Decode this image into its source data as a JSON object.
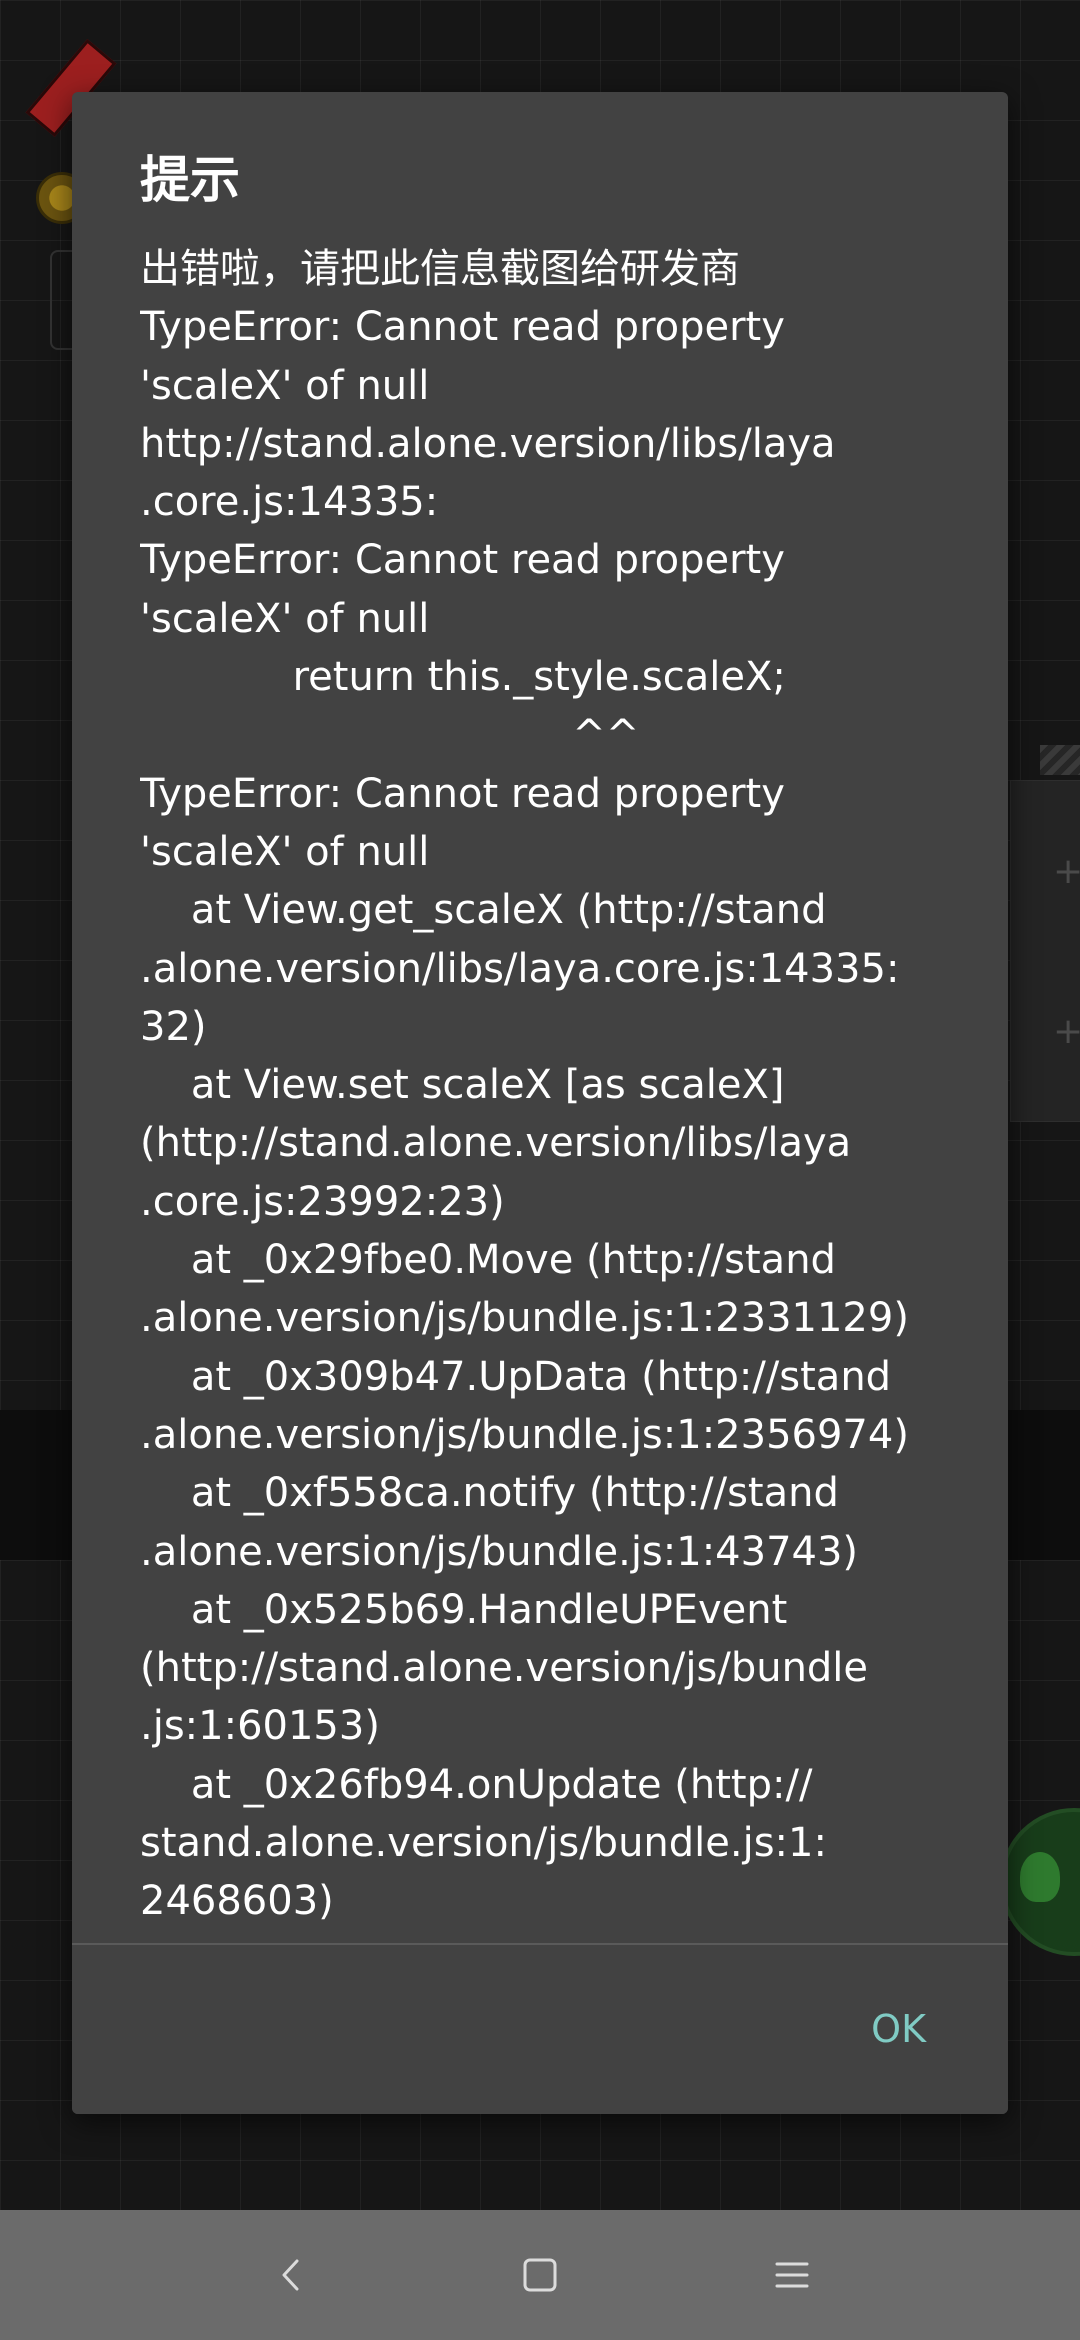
{
  "dialog": {
    "title": "提示",
    "message": "出错啦，请把此信息截图给研发商\nTypeError: Cannot read property\n'scaleX' of null\nhttp://stand.alone.version/libs/laya\n.core.js:14335:\nTypeError: Cannot read property\n'scaleX' of null\n            return this._style.scaleX;\n                                  ^^\nTypeError: Cannot read property\n'scaleX' of null\n    at View.get_scaleX (http://stand\n.alone.version/libs/laya.core.js:14335:\n32)\n    at View.set scaleX [as scaleX]\n(http://stand.alone.version/libs/laya\n.core.js:23992:23)\n    at _0x29fbe0.Move (http://stand\n.alone.version/js/bundle.js:1:2331129)\n    at _0x309b47.UpData (http://stand\n.alone.version/js/bundle.js:1:2356974)\n    at _0xf558ca.notify (http://stand\n.alone.version/js/bundle.js:1:43743)\n    at _0x525b69.HandleUPEvent\n(http://stand.alone.version/js/bundle\n.js:1:60153)\n    at _0x26fb94.onUpdate (http://\nstand.alone.version/js/bundle.js:1:\n2468603)",
    "ok_label": "OK"
  },
  "nav_bar": {
    "back_icon": "back-chevron-icon",
    "home_icon": "home-square-icon",
    "recents_icon": "menu-lines-icon"
  },
  "colors": {
    "dialog_background": "#424242",
    "accent": "#80cbc4",
    "nav_bar": "#6b6b6b"
  }
}
